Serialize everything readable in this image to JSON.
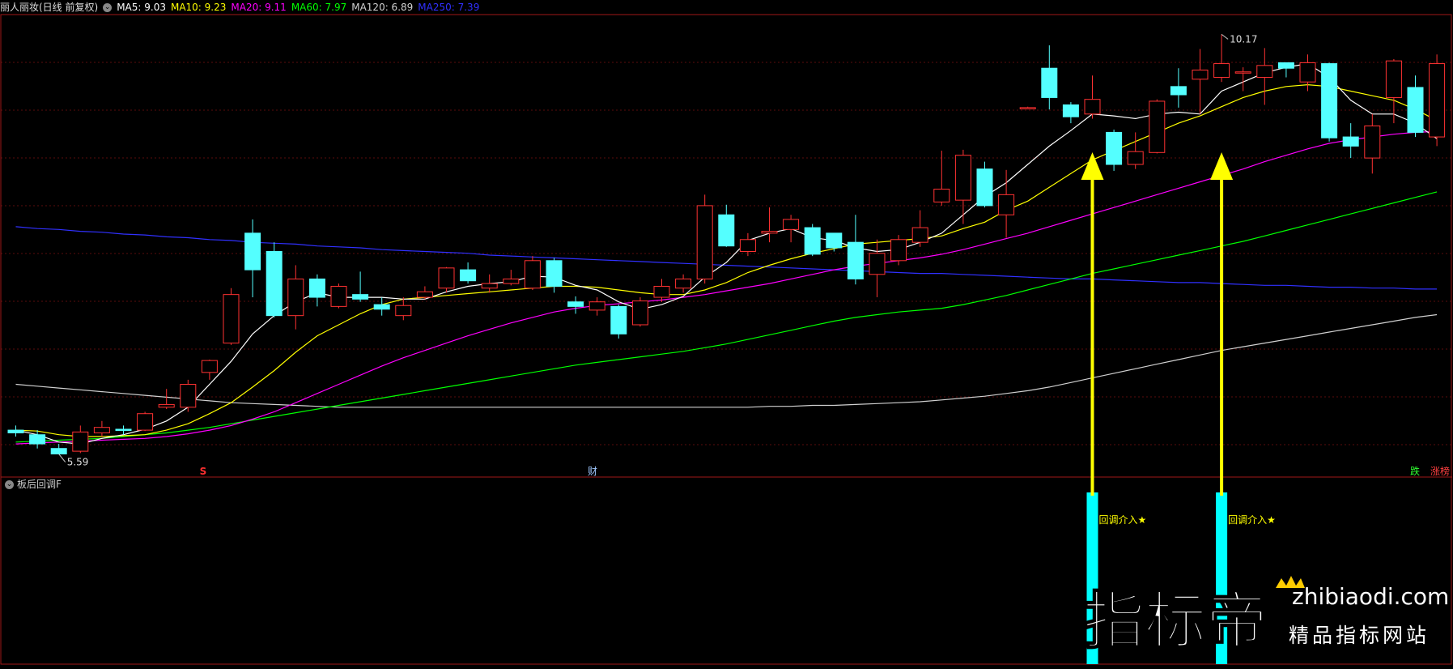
{
  "header": {
    "stock_name": "丽人丽妆(日线 前复权)",
    "ma_items": [
      {
        "label": "MA5: 9.03",
        "color": "#ffffff"
      },
      {
        "label": "MA10: 9.23",
        "color": "#ffff00"
      },
      {
        "label": "MA20: 9.11",
        "color": "#ff00ff"
      },
      {
        "label": "MA60: 7.97",
        "color": "#00ff00"
      },
      {
        "label": "MA120: 6.89",
        "color": "#d0d0d0"
      },
      {
        "label": "MA250: 7.39",
        "color": "#3030ff"
      }
    ]
  },
  "indicator": {
    "name": "板后回调F"
  },
  "markers": {
    "s_mark": "S",
    "cai_mark": "财",
    "die_mark": "跌",
    "zhang_mark": "涨榜"
  },
  "watermark": {
    "brand": "指标帝",
    "domain": "zhibiaodi.com",
    "slogan": "精品指标网站"
  },
  "chart_data": {
    "type": "candlestick",
    "price_axis": {
      "min": 5.4,
      "max": 10.35
    },
    "annotations": {
      "high_label": "10.17",
      "low_label": "5.59",
      "high_index": 56,
      "low_index": 2
    },
    "colors": {
      "up": "#ff3232",
      "down": "#54ffff",
      "ma5": "#ffffff",
      "ma10": "#ffff00",
      "ma20": "#ff00ff",
      "ma60": "#00ff00",
      "ma120": "#d0d0d0",
      "ma250": "#3030ff",
      "signal": "#00ffff",
      "arrow": "#ffff00"
    },
    "candles": [
      [
        5.85,
        5.82,
        5.9,
        5.78
      ],
      [
        5.8,
        5.7,
        5.85,
        5.65
      ],
      [
        5.65,
        5.59,
        5.7,
        5.59
      ],
      [
        5.62,
        5.83,
        5.9,
        5.6
      ],
      [
        5.82,
        5.88,
        5.95,
        5.78
      ],
      [
        5.86,
        5.85,
        5.9,
        5.8
      ],
      [
        5.85,
        6.03,
        6.05,
        5.84
      ],
      [
        6.1,
        6.13,
        6.3,
        6.08
      ],
      [
        6.1,
        6.35,
        6.4,
        6.05
      ],
      [
        6.48,
        6.61,
        6.62,
        6.4
      ],
      [
        6.8,
        7.33,
        7.4,
        6.78
      ],
      [
        8.0,
        7.6,
        8.15,
        7.3
      ],
      [
        7.8,
        7.1,
        7.9,
        7.08
      ],
      [
        7.1,
        7.5,
        7.65,
        6.95
      ],
      [
        7.5,
        7.3,
        7.55,
        7.2
      ],
      [
        7.2,
        7.42,
        7.45,
        7.18
      ],
      [
        7.33,
        7.28,
        7.58,
        7.25
      ],
      [
        7.22,
        7.17,
        7.3,
        7.1
      ],
      [
        7.1,
        7.21,
        7.3,
        7.05
      ],
      [
        7.3,
        7.36,
        7.42,
        7.28
      ],
      [
        7.4,
        7.62,
        7.63,
        7.35
      ],
      [
        7.6,
        7.48,
        7.68,
        7.45
      ],
      [
        7.4,
        7.45,
        7.55,
        7.35
      ],
      [
        7.45,
        7.5,
        7.6,
        7.43
      ],
      [
        7.4,
        7.7,
        7.75,
        7.38
      ],
      [
        7.7,
        7.42,
        7.73,
        7.35
      ],
      [
        7.25,
        7.2,
        7.31,
        7.12
      ],
      [
        7.16,
        7.25,
        7.3,
        7.1
      ],
      [
        7.2,
        6.9,
        7.22,
        6.85
      ],
      [
        7.0,
        7.26,
        7.3,
        6.98
      ],
      [
        7.3,
        7.42,
        7.5,
        7.25
      ],
      [
        7.4,
        7.5,
        7.55,
        7.35
      ],
      [
        7.5,
        8.3,
        8.42,
        7.45
      ],
      [
        8.2,
        7.86,
        8.31,
        7.85
      ],
      [
        7.8,
        7.93,
        8.0,
        7.75
      ],
      [
        8.0,
        8.02,
        8.28,
        7.9
      ],
      [
        8.04,
        8.15,
        8.2,
        7.9
      ],
      [
        8.06,
        7.77,
        8.1,
        7.75
      ],
      [
        8.0,
        7.84,
        8.0,
        7.8
      ],
      [
        7.9,
        7.5,
        8.2,
        7.44
      ],
      [
        7.55,
        7.78,
        7.93,
        7.3
      ],
      [
        7.7,
        7.93,
        7.98,
        7.65
      ],
      [
        7.9,
        8.06,
        8.25,
        7.85
      ],
      [
        8.34,
        8.48,
        8.9,
        8.3
      ],
      [
        8.36,
        8.85,
        8.91,
        8.1
      ],
      [
        8.7,
        8.3,
        8.78,
        8.28
      ],
      [
        8.2,
        8.42,
        8.69,
        7.95
      ],
      [
        9.37,
        9.37,
        9.38,
        9.37
      ],
      [
        9.8,
        9.48,
        10.05,
        9.35
      ],
      [
        9.4,
        9.27,
        9.43,
        9.2
      ],
      [
        9.3,
        9.46,
        9.72,
        9.25
      ],
      [
        9.1,
        8.75,
        9.13,
        8.68
      ],
      [
        8.75,
        8.89,
        9.1,
        8.7
      ],
      [
        8.88,
        9.44,
        9.46,
        8.87
      ],
      [
        9.6,
        9.51,
        9.8,
        9.37
      ],
      [
        9.68,
        9.78,
        10.01,
        9.3
      ],
      [
        9.7,
        9.85,
        10.17,
        9.65
      ],
      [
        9.75,
        9.76,
        9.81,
        9.55
      ],
      [
        9.7,
        9.83,
        10.02,
        9.4
      ],
      [
        9.86,
        9.8,
        9.85,
        9.7
      ],
      [
        9.65,
        9.86,
        9.95,
        9.55
      ],
      [
        9.85,
        9.04,
        9.86,
        9.0
      ],
      [
        9.05,
        8.95,
        9.2,
        8.82
      ],
      [
        8.82,
        9.17,
        9.3,
        8.65
      ],
      [
        9.48,
        9.88,
        9.9,
        9.2
      ],
      [
        9.59,
        9.1,
        9.72,
        9.05
      ],
      [
        9.05,
        9.85,
        9.95,
        8.95
      ]
    ],
    "ma5": [
      5.85,
      5.8,
      5.72,
      5.7,
      5.76,
      5.8,
      5.86,
      5.95,
      6.1,
      6.35,
      6.6,
      6.9,
      7.1,
      7.25,
      7.35,
      7.3,
      7.3,
      7.3,
      7.28,
      7.28,
      7.36,
      7.42,
      7.45,
      7.47,
      7.53,
      7.52,
      7.43,
      7.38,
      7.25,
      7.17,
      7.22,
      7.31,
      7.52,
      7.68,
      7.92,
      8.0,
      8.05,
      7.95,
      7.92,
      7.84,
      7.8,
      7.82,
      7.9,
      8.0,
      8.2,
      8.4,
      8.55,
      8.75,
      8.95,
      9.12,
      9.3,
      9.28,
      9.25,
      9.3,
      9.32,
      9.3,
      9.55,
      9.65,
      9.75,
      9.81,
      9.85,
      9.7,
      9.45,
      9.3,
      9.3,
      9.2,
      9.03
    ],
    "ma10": [
      5.85,
      5.84,
      5.8,
      5.78,
      5.78,
      5.79,
      5.8,
      5.85,
      5.92,
      6.03,
      6.15,
      6.32,
      6.5,
      6.7,
      6.88,
      7.0,
      7.12,
      7.22,
      7.28,
      7.3,
      7.32,
      7.34,
      7.36,
      7.38,
      7.4,
      7.42,
      7.42,
      7.41,
      7.38,
      7.35,
      7.33,
      7.33,
      7.38,
      7.46,
      7.57,
      7.65,
      7.72,
      7.78,
      7.83,
      7.88,
      7.9,
      7.92,
      7.94,
      7.97,
      8.05,
      8.12,
      8.25,
      8.35,
      8.5,
      8.65,
      8.8,
      8.9,
      9.0,
      9.1,
      9.2,
      9.28,
      9.38,
      9.48,
      9.55,
      9.6,
      9.62,
      9.6,
      9.55,
      9.5,
      9.45,
      9.35,
      9.23
    ],
    "ma20": [
      5.7,
      5.71,
      5.72,
      5.73,
      5.74,
      5.75,
      5.76,
      5.78,
      5.81,
      5.85,
      5.9,
      5.97,
      6.05,
      6.15,
      6.25,
      6.35,
      6.45,
      6.55,
      6.64,
      6.72,
      6.8,
      6.88,
      6.95,
      7.02,
      7.08,
      7.14,
      7.18,
      7.21,
      7.23,
      7.25,
      7.27,
      7.3,
      7.33,
      7.37,
      7.41,
      7.45,
      7.5,
      7.55,
      7.6,
      7.64,
      7.67,
      7.7,
      7.73,
      7.77,
      7.82,
      7.88,
      7.94,
      8.0,
      8.07,
      8.14,
      8.21,
      8.28,
      8.35,
      8.42,
      8.49,
      8.56,
      8.63,
      8.7,
      8.78,
      8.85,
      8.92,
      8.98,
      9.02,
      9.05,
      9.08,
      9.1,
      9.11
    ],
    "ma60": [
      5.72,
      5.73,
      5.74,
      5.75,
      5.76,
      5.78,
      5.8,
      5.82,
      5.85,
      5.88,
      5.92,
      5.96,
      6.0,
      6.04,
      6.08,
      6.12,
      6.16,
      6.2,
      6.24,
      6.28,
      6.32,
      6.36,
      6.4,
      6.44,
      6.48,
      6.52,
      6.56,
      6.59,
      6.62,
      6.65,
      6.68,
      6.71,
      6.75,
      6.79,
      6.84,
      6.89,
      6.94,
      6.99,
      7.04,
      7.08,
      7.11,
      7.14,
      7.16,
      7.18,
      7.22,
      7.27,
      7.32,
      7.38,
      7.44,
      7.5,
      7.56,
      7.61,
      7.66,
      7.71,
      7.76,
      7.81,
      7.86,
      7.91,
      7.97,
      8.03,
      8.09,
      8.15,
      8.21,
      8.27,
      8.33,
      8.39,
      8.45
    ],
    "ma120": [
      6.35,
      6.33,
      6.31,
      6.29,
      6.27,
      6.25,
      6.23,
      6.21,
      6.19,
      6.17,
      6.15,
      6.14,
      6.13,
      6.12,
      6.11,
      6.1,
      6.1,
      6.1,
      6.1,
      6.1,
      6.1,
      6.1,
      6.1,
      6.1,
      6.1,
      6.1,
      6.1,
      6.1,
      6.1,
      6.1,
      6.1,
      6.1,
      6.1,
      6.1,
      6.1,
      6.11,
      6.11,
      6.12,
      6.12,
      6.13,
      6.14,
      6.15,
      6.16,
      6.18,
      6.2,
      6.22,
      6.25,
      6.28,
      6.32,
      6.37,
      6.42,
      6.47,
      6.52,
      6.57,
      6.62,
      6.67,
      6.72,
      6.76,
      6.8,
      6.84,
      6.88,
      6.92,
      6.96,
      7.0,
      7.04,
      7.08,
      7.11
    ],
    "ma250": [
      8.07,
      8.05,
      8.04,
      8.02,
      8.01,
      7.99,
      7.98,
      7.96,
      7.95,
      7.93,
      7.92,
      7.9,
      7.89,
      7.88,
      7.86,
      7.85,
      7.84,
      7.82,
      7.81,
      7.8,
      7.79,
      7.78,
      7.76,
      7.75,
      7.74,
      7.73,
      7.72,
      7.71,
      7.7,
      7.69,
      7.68,
      7.67,
      7.66,
      7.65,
      7.64,
      7.63,
      7.62,
      7.61,
      7.6,
      7.59,
      7.58,
      7.57,
      7.56,
      7.56,
      7.55,
      7.54,
      7.53,
      7.52,
      7.51,
      7.5,
      7.5,
      7.49,
      7.48,
      7.47,
      7.46,
      7.46,
      7.45,
      7.44,
      7.43,
      7.43,
      7.42,
      7.41,
      7.41,
      7.4,
      7.4,
      7.39,
      7.39
    ],
    "signals": [
      {
        "index": 50,
        "label": "回调介入★"
      },
      {
        "index": 56,
        "label": "回调介入★"
      }
    ]
  }
}
